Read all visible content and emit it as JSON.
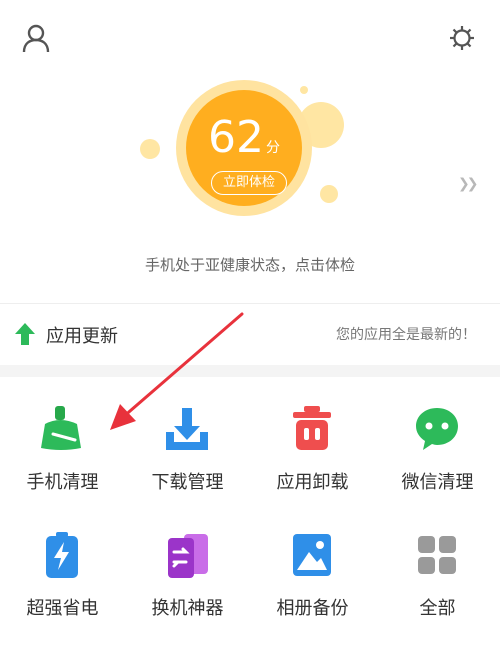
{
  "header": {
    "user_icon": "user-icon",
    "settings_icon": "gear-icon"
  },
  "health": {
    "score": "62",
    "unit": "分",
    "check_button": "立即体检",
    "hint": "手机处于亚健康状态，点击体检",
    "score_color": "#ffae1f"
  },
  "updates": {
    "title": "应用更新",
    "status": "您的应用全是最新的！",
    "accent": "#2dba5a"
  },
  "tools": [
    {
      "label": "手机清理",
      "icon": "broom-icon"
    },
    {
      "label": "下载管理",
      "icon": "download-icon"
    },
    {
      "label": "应用卸载",
      "icon": "trash-icon"
    },
    {
      "label": "微信清理",
      "icon": "wechat-icon"
    },
    {
      "label": "超强省电",
      "icon": "battery-icon"
    },
    {
      "label": "换机神器",
      "icon": "phone-transfer-icon"
    },
    {
      "label": "相册备份",
      "icon": "photo-icon"
    },
    {
      "label": "全部",
      "icon": "grid-icon"
    }
  ]
}
